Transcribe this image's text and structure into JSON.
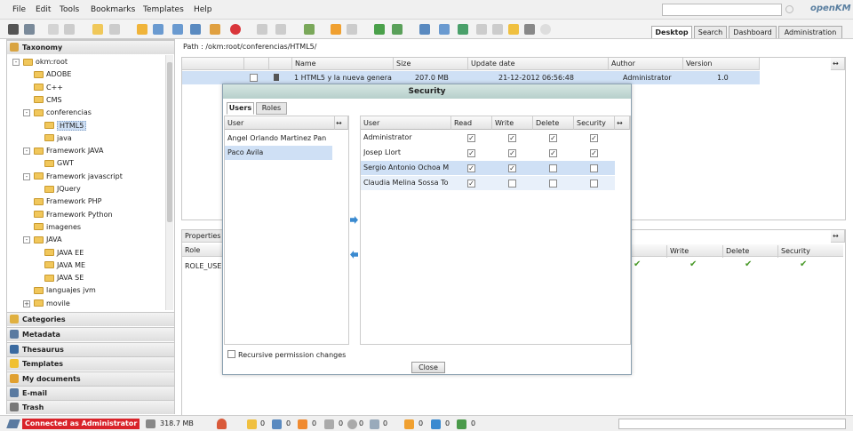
{
  "menu": {
    "items": [
      "File",
      "Edit",
      "Tools",
      "Bookmarks",
      "Templates",
      "Help"
    ]
  },
  "brand": {
    "logo": "openKM"
  },
  "tabs": [
    "Desktop",
    "Search",
    "Dashboard",
    "Administration"
  ],
  "left": {
    "taxonomy_label": "Taxonomy",
    "tree": [
      {
        "label": "okm:root",
        "level": 0,
        "exp": "-"
      },
      {
        "label": "ADOBE",
        "level": 1
      },
      {
        "label": "C++",
        "level": 1
      },
      {
        "label": "CMS",
        "level": 1
      },
      {
        "label": "conferencias",
        "level": 1,
        "exp": "-"
      },
      {
        "label": "HTML5",
        "level": 2,
        "selected": true
      },
      {
        "label": "java",
        "level": 2
      },
      {
        "label": "Framework JAVA",
        "level": 1,
        "exp": "-"
      },
      {
        "label": "GWT",
        "level": 2
      },
      {
        "label": "Framework javascript",
        "level": 1,
        "exp": "-"
      },
      {
        "label": "JQuery",
        "level": 2
      },
      {
        "label": "Framework PHP",
        "level": 1
      },
      {
        "label": "Framework Python",
        "level": 1
      },
      {
        "label": "imagenes",
        "level": 1
      },
      {
        "label": "JAVA",
        "level": 1,
        "exp": "-"
      },
      {
        "label": "JAVA EE",
        "level": 2
      },
      {
        "label": "JAVA ME",
        "level": 2
      },
      {
        "label": "JAVA SE",
        "level": 2
      },
      {
        "label": "languajes jvm",
        "level": 1
      },
      {
        "label": "movile",
        "level": 1,
        "exp": "+"
      }
    ],
    "sections": [
      "Categories",
      "Metadata",
      "Thesaurus",
      "Templates",
      "My documents",
      "E-mail",
      "Trash"
    ]
  },
  "path": {
    "text": "Path : /okm:root/conferencias/HTML5/"
  },
  "filelist": {
    "columns": [
      "Name",
      "Size",
      "Update date",
      "Author",
      "Version"
    ],
    "row": {
      "name": "1 HTML5 y la nueva genera",
      "size": "207.0 MB",
      "date": "21-12-2012 06:56:48",
      "author": "Administrator",
      "version": "1.0"
    }
  },
  "props": {
    "tab_label": "Properties",
    "role_col": "Role",
    "role_value": "ROLE_USER",
    "perm_cols": [
      "Write",
      "Delete",
      "Security"
    ]
  },
  "dialog": {
    "title": "Security",
    "tabs": [
      "Users",
      "Roles"
    ],
    "left_header": "User",
    "left_users": [
      "Angel Orlando Martinez Pan",
      "Paco Avila"
    ],
    "right_headers": [
      "User",
      "Read",
      "Write",
      "Delete",
      "Security"
    ],
    "right_rows": [
      {
        "user": "Administrator",
        "perms": [
          true,
          true,
          true,
          true
        ]
      },
      {
        "user": "Josep Llort",
        "perms": [
          true,
          true,
          true,
          true
        ]
      },
      {
        "user": "Sergio Antonio Ochoa M",
        "perms": [
          true,
          true,
          false,
          false
        ]
      },
      {
        "user": "Claudia Melina Sossa To",
        "perms": [
          true,
          false,
          false,
          false
        ]
      }
    ],
    "recursive_label": "Recursive permission changes",
    "close_label": "Close"
  },
  "status": {
    "connected": "Connected as Administrator",
    "memory": "318.7 MB",
    "counts": [
      "0",
      "0",
      "0",
      "0",
      "0",
      "0",
      "0",
      "0",
      "0"
    ]
  },
  "colors": {
    "accent": "#cfe0f5",
    "status_red": "#d9232a"
  }
}
